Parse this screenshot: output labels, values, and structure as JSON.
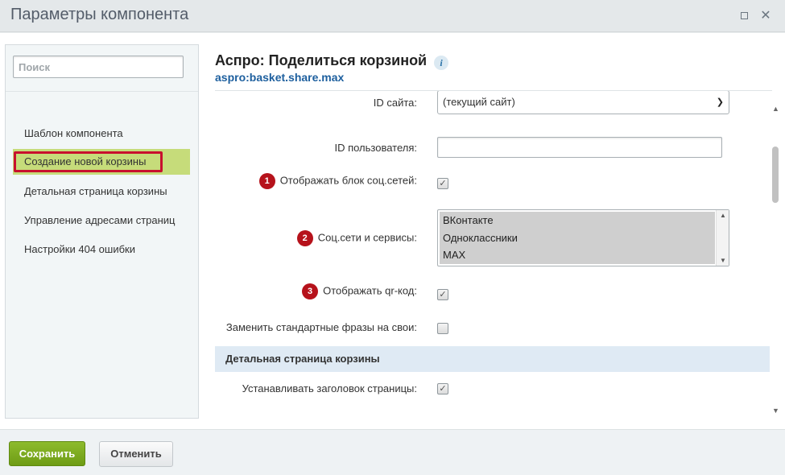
{
  "window": {
    "title": "Параметры компонента"
  },
  "sidebar": {
    "search_placeholder": "Поиск",
    "items": [
      {
        "label": "Шаблон компонента"
      },
      {
        "label": "Создание новой корзины"
      },
      {
        "label": "Детальная страница корзины"
      },
      {
        "label": "Управление адресами страниц"
      },
      {
        "label": "Настройки 404 ошибки"
      }
    ],
    "active_index": 1
  },
  "component": {
    "title": "Аспро: Поделиться корзиной",
    "code": "aspro:basket.share.max",
    "info_icon": "i"
  },
  "params": {
    "site_id": {
      "label": "ID сайта:",
      "value": "(текущий сайт)"
    },
    "user_id": {
      "label": "ID пользователя:",
      "value": ""
    },
    "show_social": {
      "label": "Отображать блок соц.сетей:",
      "badge": "1",
      "checked": true
    },
    "social_services": {
      "label": "Соц.сети и сервисы:",
      "badge": "2",
      "options": [
        "ВКонтакте",
        "Одноклассники",
        "MAX"
      ]
    },
    "show_qr": {
      "label": "Отображать qr-код:",
      "badge": "3",
      "checked": true
    },
    "replace_phrases": {
      "label": "Заменить стандартные фразы на свои:",
      "checked": false
    },
    "section_detail": {
      "label": "Детальная страница корзины"
    },
    "set_title": {
      "label": "Устанавливать заголовок страницы:",
      "checked": true
    }
  },
  "footer": {
    "save_label": "Сохранить",
    "cancel_label": "Отменить"
  },
  "colors": {
    "active_nav": "#c6dc7a",
    "badge": "#b6121b",
    "save_button": "#7aa81f",
    "section_header": "#dfeaf4",
    "component_code": "#1d5f9e"
  }
}
